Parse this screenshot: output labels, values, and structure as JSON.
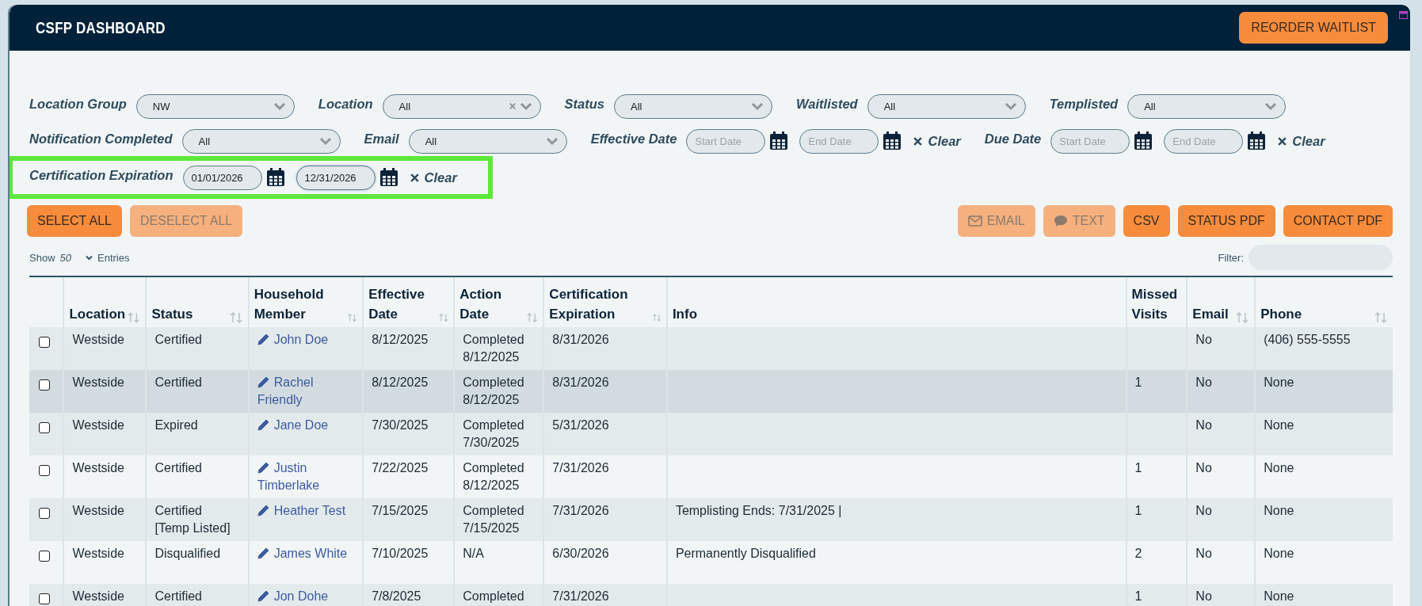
{
  "window": {
    "title": "CSFP DASHBOARD"
  },
  "header_button": {
    "label": "REORDER WAITLIST"
  },
  "filter_rows": [
    {
      "highlighted": false,
      "filters": [
        {
          "kind": "select",
          "label": "Location Group",
          "value": "NW",
          "clearable": false
        },
        {
          "kind": "select",
          "label": "Location",
          "value": "All",
          "clearable": true
        },
        {
          "kind": "select",
          "label": "Status",
          "value": "All",
          "clearable": false
        },
        {
          "kind": "select",
          "label": "Waitlisted",
          "value": "All",
          "clearable": false
        },
        {
          "kind": "select",
          "label": "Templisted",
          "value": "All",
          "clearable": false
        }
      ]
    },
    {
      "highlighted": false,
      "filters": [
        {
          "kind": "select",
          "label": "Notification Completed",
          "value": "All",
          "clearable": false
        },
        {
          "kind": "select",
          "label": "Email",
          "value": "All",
          "clearable": false
        },
        {
          "kind": "date_range",
          "label": "Effective Date",
          "start": {
            "placeholder": "Start Date"
          },
          "end": {
            "placeholder": "End Date"
          },
          "clear": "Clear"
        },
        {
          "kind": "date_range",
          "label": "Due Date",
          "start": {
            "placeholder": "Start Date"
          },
          "end": {
            "placeholder": "End Date"
          },
          "clear": "Clear"
        }
      ]
    },
    {
      "highlighted": true,
      "filters": [
        {
          "kind": "date_range",
          "label": "Certification Expiration",
          "start": {
            "value": "01/01/2026"
          },
          "end": {
            "value": "12/31/2026"
          },
          "clear": "Clear"
        }
      ]
    }
  ],
  "left_buttons": [
    {
      "label": "SELECT ALL",
      "disabled": false
    },
    {
      "label": "DESELECT ALL",
      "disabled": true
    }
  ],
  "right_buttons": [
    {
      "label": "EMAIL",
      "kind": "mail",
      "disabled": true
    },
    {
      "label": "TEXT",
      "kind": "sms",
      "disabled": true
    },
    {
      "label": "CSV",
      "kind": "plain",
      "disabled": false
    },
    {
      "label": "STATUS PDF",
      "kind": "plain",
      "disabled": false
    },
    {
      "label": "CONTACT PDF",
      "kind": "plain",
      "disabled": false
    }
  ],
  "entries": {
    "show": "Show",
    "count": "50",
    "entries": "Entries"
  },
  "filter": {
    "label": "Filter:"
  },
  "table": {
    "columns": [
      {
        "label": "Location",
        "sortable": true,
        "kind": "text"
      },
      {
        "label": "Status",
        "sortable": true,
        "kind": "text"
      },
      {
        "label": "Household Member",
        "sortable": true,
        "kind": "link"
      },
      {
        "label": "Effective Date",
        "sortable": true,
        "kind": "text"
      },
      {
        "label": "Action Date",
        "sortable": true,
        "kind": "text"
      },
      {
        "label": "Certification Expiration",
        "sortable": true,
        "kind": "text"
      },
      {
        "label": "Info",
        "sortable": false,
        "kind": "text"
      },
      {
        "label": "Missed Visits",
        "sortable": false,
        "kind": "text"
      },
      {
        "label": "Email",
        "sortable": true,
        "kind": "text"
      },
      {
        "label": "Phone",
        "sortable": true,
        "kind": "text"
      }
    ],
    "rows": [
      {
        "checked": false,
        "hovered": false,
        "cells": [
          "Westside",
          "Certified",
          "John Doe",
          "8/12/2025",
          "Completed 8/12/2025",
          "8/31/2026",
          "",
          "",
          "No",
          "(406) 555-5555"
        ]
      },
      {
        "checked": false,
        "hovered": true,
        "cells": [
          "Westside",
          "Certified",
          "Rachel Friendly",
          "8/12/2025",
          "Completed 8/12/2025",
          "8/31/2026",
          "",
          "1",
          "No",
          "None"
        ]
      },
      {
        "checked": false,
        "hovered": false,
        "cells": [
          "Westside",
          "Expired",
          "Jane Doe",
          "7/30/2025",
          "Completed 7/30/2025",
          "5/31/2026",
          "",
          "",
          "No",
          "None"
        ]
      },
      {
        "checked": false,
        "hovered": false,
        "cells": [
          "Westside",
          "Certified",
          "Justin Timberlake",
          "7/22/2025",
          "Completed 8/12/2025",
          "7/31/2026",
          "",
          "1",
          "No",
          "None"
        ]
      },
      {
        "checked": false,
        "hovered": false,
        "cells": [
          "Westside",
          "Certified [Temp Listed]",
          "Heather Test",
          "7/15/2025",
          "Completed 7/15/2025",
          "7/31/2026",
          "Templisting Ends: 7/31/2025 |",
          "1",
          "No",
          "None"
        ]
      },
      {
        "checked": false,
        "hovered": false,
        "cells": [
          "Westside",
          "Disqualified",
          "James White",
          "7/10/2025",
          "N/A",
          "6/30/2026",
          "Permanently Disqualified",
          "2",
          "No",
          "None"
        ]
      },
      {
        "checked": false,
        "hovered": false,
        "cells": [
          "Westside",
          "Certified",
          "Jon Dohe",
          "7/8/2025",
          "Completed",
          "7/31/2026",
          "",
          "1",
          "No",
          "None"
        ]
      }
    ]
  }
}
